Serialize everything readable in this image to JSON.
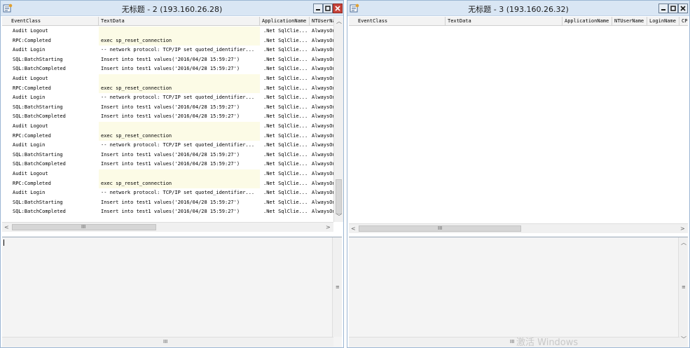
{
  "left_window": {
    "title": "无标题 - 2 (193.160.26.28)",
    "columns": [
      "EventClass",
      "TextData",
      "ApplicationName",
      "NTUserName"
    ],
    "rows": [
      {
        "event": "Audit Logout",
        "text": "",
        "app": ".Net SqlClie...",
        "user": "AlwaysOn"
      },
      {
        "event": "RPC:Completed",
        "text": "exec sp_reset_connection",
        "app": ".Net SqlClie...",
        "user": "AlwaysOn"
      },
      {
        "event": "Audit Login",
        "text": "-- network protocol: TCP/IP  set quoted_identifier...",
        "app": ".Net SqlClie...",
        "user": "AlwaysOn"
      },
      {
        "event": "SQL:BatchStarting",
        "text": "Insert into test1 values('2016/04/28 15:59:27')",
        "app": ".Net SqlClie...",
        "user": "AlwaysOn"
      },
      {
        "event": "SQL:BatchCompleted",
        "text": "Insert into test1 values('2016/04/28 15:59:27')",
        "app": ".Net SqlClie...",
        "user": "AlwaysOn"
      },
      {
        "event": "Audit Logout",
        "text": "",
        "app": ".Net SqlClie...",
        "user": "AlwaysOn"
      },
      {
        "event": "RPC:Completed",
        "text": "exec sp_reset_connection",
        "app": ".Net SqlClie...",
        "user": "AlwaysOn"
      },
      {
        "event": "Audit Login",
        "text": "-- network protocol: TCP/IP  set quoted_identifier...",
        "app": ".Net SqlClie...",
        "user": "AlwaysOn"
      },
      {
        "event": "SQL:BatchStarting",
        "text": "Insert into test1 values('2016/04/28 15:59:27')",
        "app": ".Net SqlClie...",
        "user": "AlwaysOn"
      },
      {
        "event": "SQL:BatchCompleted",
        "text": "Insert into test1 values('2016/04/28 15:59:27')",
        "app": ".Net SqlClie...",
        "user": "AlwaysOn"
      },
      {
        "event": "Audit Logout",
        "text": "",
        "app": ".Net SqlClie...",
        "user": "AlwaysOn"
      },
      {
        "event": "RPC:Completed",
        "text": "exec sp_reset_connection",
        "app": ".Net SqlClie...",
        "user": "AlwaysOn"
      },
      {
        "event": "Audit Login",
        "text": "-- network protocol: TCP/IP  set quoted_identifier...",
        "app": ".Net SqlClie...",
        "user": "AlwaysOn"
      },
      {
        "event": "SQL:BatchStarting",
        "text": "Insert into test1 values('2016/04/28 15:59:27')",
        "app": ".Net SqlClie...",
        "user": "AlwaysOn"
      },
      {
        "event": "SQL:BatchCompleted",
        "text": "Insert into test1 values('2016/04/28 15:59:27')",
        "app": ".Net SqlClie...",
        "user": "AlwaysOn"
      },
      {
        "event": "Audit Logout",
        "text": "",
        "app": ".Net SqlClie...",
        "user": "AlwaysOn"
      },
      {
        "event": "RPC:Completed",
        "text": "exec sp_reset_connection",
        "app": ".Net SqlClie...",
        "user": "AlwaysOn"
      },
      {
        "event": "Audit Login",
        "text": "-- network protocol: TCP/IP  set quoted_identifier...",
        "app": ".Net SqlClie...",
        "user": "AlwaysOn"
      },
      {
        "event": "SQL:BatchStarting",
        "text": "Insert into test1 values('2016/04/28 15:59:27')",
        "app": ".Net SqlClie...",
        "user": "AlwaysOn"
      },
      {
        "event": "SQL:BatchCompleted",
        "text": "Insert into test1 values('2016/04/28 15:59:27')",
        "app": ".Net SqlClie...",
        "user": "AlwaysOn"
      }
    ]
  },
  "right_window": {
    "title": "无标题 - 3 (193.160.26.32)",
    "columns": [
      "EventClass",
      "TextData",
      "ApplicationName",
      "NTUserName",
      "LoginName",
      "CP"
    ]
  },
  "scroll_grip": "III",
  "watermark": "激活 Windows",
  "colors": {
    "titlebar": "#d9e6f4",
    "border": "#9bb6d3",
    "highlight_cell": "#fcfbe6",
    "close_button": "#c7433a"
  },
  "icons": {
    "app": "profiler-trace-icon",
    "minimize": "minimize-icon",
    "restore": "restore-icon",
    "close": "close-icon"
  }
}
